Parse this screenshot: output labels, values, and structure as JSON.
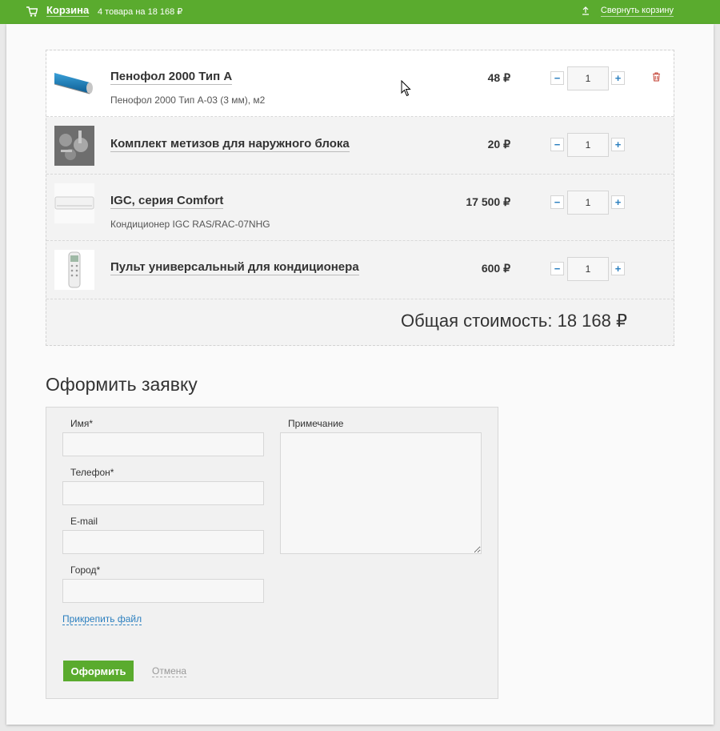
{
  "topbar": {
    "title": "Корзина",
    "summary": "4 товара на 18 168 ₽",
    "collapse_label": "Свернуть корзину",
    "color": "#5aab2e"
  },
  "cart": {
    "items": [
      {
        "name": "Пенофол 2000 Тип А",
        "description": "Пенофол 2000 Тип А-03 (3 мм), м2",
        "price": "48 ₽",
        "quantity": "1",
        "thumb_icon": "foil-roll-image"
      },
      {
        "name": "Комплект метизов для наружного блока",
        "description": "",
        "price": "20 ₽",
        "quantity": "1",
        "thumb_icon": "hardware-kit-image"
      },
      {
        "name": "IGC, серия Comfort",
        "description": "Кондиционер IGC RAS/RAC-07NHG",
        "price": "17 500 ₽",
        "quantity": "1",
        "thumb_icon": "air-conditioner-image"
      },
      {
        "name": "Пульт универсальный для кондиционера",
        "description": "",
        "price": "600 ₽",
        "quantity": "1",
        "thumb_icon": "remote-control-image"
      }
    ],
    "minus_label": "−",
    "plus_label": "+",
    "total_label": "Общая стоимость: 18 168 ₽"
  },
  "order": {
    "title": "Оформить заявку",
    "name_label": "Имя*",
    "phone_label": "Телефон*",
    "email_label": "E-mail",
    "city_label": "Город*",
    "note_label": "Примечание",
    "attach_label": "Прикрепить файл",
    "submit_label": "Оформить",
    "cancel_label": "Отмена",
    "name_value": "",
    "phone_value": "",
    "email_value": "",
    "city_value": "",
    "note_value": ""
  }
}
